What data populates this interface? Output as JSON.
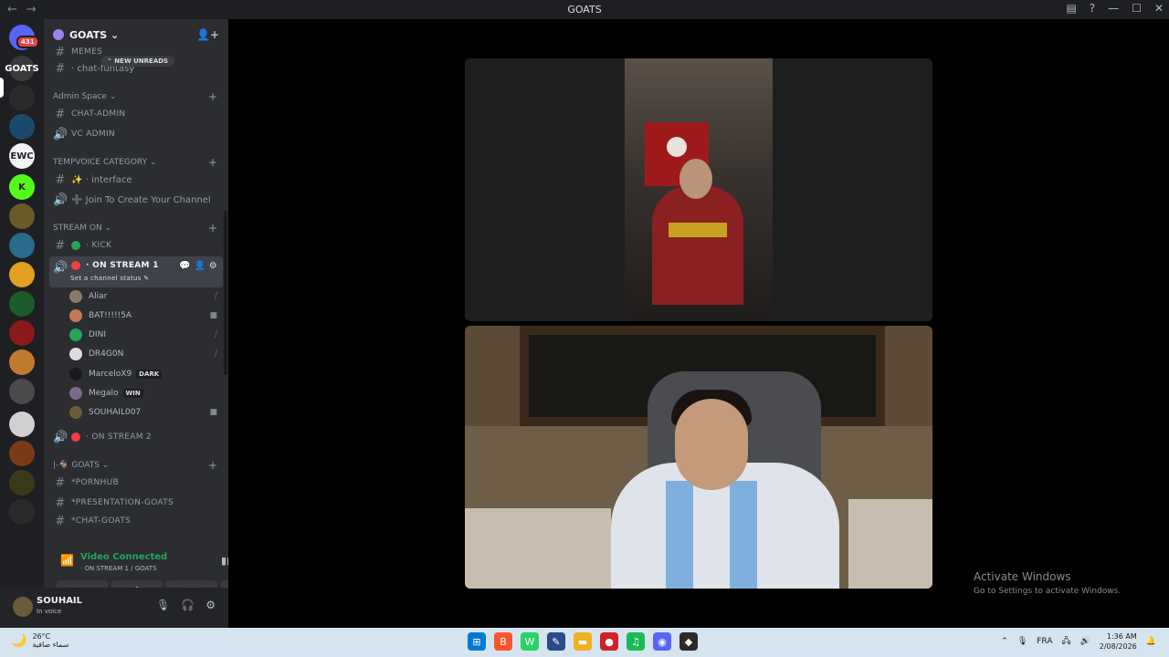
{
  "window": {
    "title": "GOATS",
    "back": "←",
    "forward": "→",
    "controls": {
      "inbox": "▤",
      "help": "?",
      "minimize": "—",
      "maximize": "☐",
      "close": "✕"
    }
  },
  "servers": {
    "home_badge": "431",
    "items": [
      {
        "label": "",
        "color": "#5865f2"
      },
      {
        "label": "GOATS",
        "color": "#3a3a3a"
      },
      {
        "label": "",
        "color": "#2a2a2a"
      },
      {
        "label": "",
        "color": "#1a4a6a"
      },
      {
        "label": "EWC",
        "color": "#f2f3f5"
      },
      {
        "label": "K",
        "color": "#53fc18"
      },
      {
        "label": "",
        "color": "#6a5a2a"
      },
      {
        "label": "",
        "color": "#2a6a8a"
      },
      {
        "label": "",
        "color": "#e0a020"
      },
      {
        "label": "",
        "color": "#1f5a2a"
      },
      {
        "label": "",
        "color": "#8a1a1a"
      },
      {
        "label": "",
        "color": "#c07a30"
      },
      {
        "label": "",
        "color": "#4a4a4a"
      },
      {
        "label": "",
        "color": "#d0d0d0"
      },
      {
        "label": "",
        "color": "#7a3a1a"
      },
      {
        "label": "",
        "color": "#3a3a1a"
      },
      {
        "label": "",
        "color": "#2a2a2a"
      }
    ]
  },
  "guild": {
    "name": "GOATS ⌄",
    "invite_icon": "👤+"
  },
  "new_unreads": "⌃ NEW UNREADS",
  "channels": {
    "memes": "MEMES",
    "chat_funtasy": "· chat-funtasy",
    "cat_admin": "Admin Space ⌄",
    "chat_admin": "CHAT-ADMIN",
    "vc_admin": "VC ADMIN",
    "cat_tempvoice": "TEMPVOICE CATEGORY ⌄",
    "interface": "✨ · interface",
    "join_create": "➕ Join To Create Your Channel",
    "cat_stream": "STREAM ON ⌄",
    "kick": "· KICK",
    "on_stream_1": "· ON STREAM 1",
    "set_status": "Set a channel status ✎",
    "on_stream_2": "· ON STREAM 2",
    "cat_goats": "|-🐐 GOATS ⌄",
    "pornhub": "*PORNHUB",
    "presentation": "*PRESENTATION-GOATS",
    "chat_goats": "*CHAT-GOATS"
  },
  "voice_users": [
    {
      "name": "Aliar",
      "tag": "",
      "right": "⧸",
      "color": "#8a7a6a"
    },
    {
      "name": "BAT!!!!!5A",
      "tag": "",
      "right": "■",
      "color": "#c07a5a"
    },
    {
      "name": "DINI",
      "tag": "",
      "right": "⧸",
      "color": "#23a55a"
    },
    {
      "name": "DR4G0N",
      "tag": "",
      "right": "⧸",
      "color": "#dddddd"
    },
    {
      "name": "MarceloX9",
      "tag": "DARK",
      "right": "",
      "color": "#1a1a1a"
    },
    {
      "name": "Megalo",
      "tag": "WIN",
      "right": "",
      "color": "#7a6a8a"
    },
    {
      "name": "SOUHAIL007",
      "tag": "",
      "right": "■",
      "color": "#6b5b3a"
    }
  ],
  "voice": {
    "status": "Video Connected",
    "location": "· ON STREAM 1 / GOATS",
    "buttons": [
      "▶",
      "⇪",
      "✦",
      "♪"
    ]
  },
  "me": {
    "name": "SOUHAIL",
    "status": "In voice"
  },
  "watermark": {
    "line1": "Activate Windows",
    "line2": "Go to Settings to activate Windows."
  },
  "taskbar": {
    "temp": "26°C",
    "weather_desc": "سماء صافية",
    "lang": "FRA",
    "time": "1:36 AM",
    "date": "2/08/2026",
    "apps": [
      {
        "name": "windows",
        "glyph": "⊞",
        "color": "#0078d4"
      },
      {
        "name": "brave",
        "glyph": "B",
        "color": "#fb542b"
      },
      {
        "name": "whatsapp",
        "glyph": "W",
        "color": "#25d366"
      },
      {
        "name": "editor",
        "glyph": "✎",
        "color": "#2a4a8a"
      },
      {
        "name": "explorer",
        "glyph": "▬",
        "color": "#f0b020"
      },
      {
        "name": "record",
        "glyph": "●",
        "color": "#d0202a"
      },
      {
        "name": "spotify",
        "glyph": "♫",
        "color": "#1db954"
      },
      {
        "name": "discord",
        "glyph": "◉",
        "color": "#5865f2"
      },
      {
        "name": "media",
        "glyph": "◆",
        "color": "#2a2a2a"
      }
    ]
  }
}
